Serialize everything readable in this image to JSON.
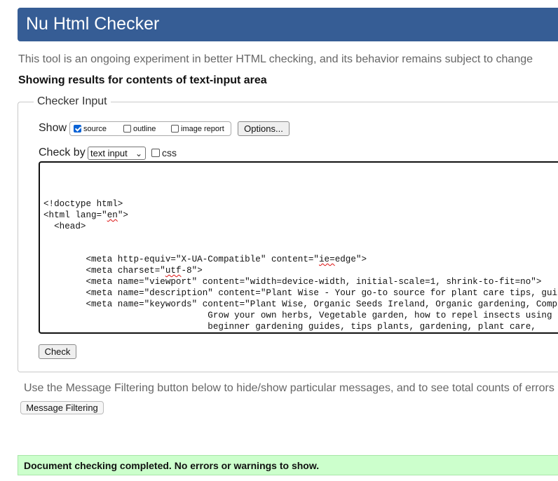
{
  "header": {
    "title": "Nu Html Checker"
  },
  "intro": "This tool is an ongoing experiment in better HTML checking, and its behavior remains subject to change",
  "results_heading": "Showing results for contents of text-input area",
  "checker": {
    "legend": "Checker Input",
    "show_label": "Show",
    "show_options": [
      {
        "label": "source",
        "checked": true
      },
      {
        "label": "outline",
        "checked": false
      },
      {
        "label": "image report",
        "checked": false
      }
    ],
    "options_button": "Options...",
    "check_by_label": "Check by",
    "check_by_value": "text input",
    "css_label": "css",
    "css_checked": false,
    "check_button": "Check"
  },
  "code_lines": [
    "<!doctype html>",
    "<html lang=\"en\">",
    "  <head>",
    "        <meta http-equiv=\"X-UA-Compatible\" content=\"ie=edge\">",
    "        <meta charset=\"utf-8\">",
    "        <meta name=\"viewport\" content=\"width=device-width, initial-scale=1, shrink-to-fit=no\">",
    "        <meta name=\"description\" content=\"Plant Wise - Your go-to source for plant care tips, guide",
    "        <meta name=\"keywords\" content=\"Plant Wise, Organic Seeds Ireland, Organic gardening, Compan",
    "                               Grow your own herbs, Vegetable garden, how to repel insects using fle",
    "                               beginner gardening guides, tips plants, gardening, plant care,"
  ],
  "filter_text": "Use the Message Filtering button below to hide/show particular messages, and to see total counts of errors a",
  "filter_button": "Message Filtering",
  "success_message": "Document checking completed. No errors or warnings to show.",
  "colors": {
    "header_bg": "#365d95",
    "success_bg": "#ccffcc",
    "checkbox_checked": "#0b63d6"
  }
}
